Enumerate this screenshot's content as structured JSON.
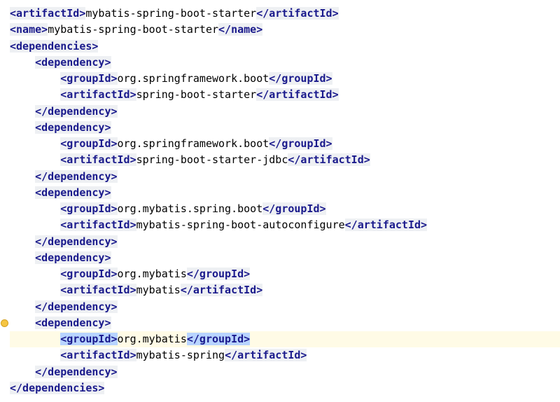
{
  "tags": {
    "artifactId_open": "<artifactId>",
    "artifactId_close": "</artifactId>",
    "name_open": "<name>",
    "name_close": "</name>",
    "dependencies_open": "<dependencies>",
    "dependencies_close": "</dependencies>",
    "dependency_open": "<dependency>",
    "dependency_close": "</dependency>",
    "groupId_open": "<groupId>",
    "groupId_close": "</groupId>"
  },
  "header": {
    "artifactId": "mybatis-spring-boot-starter",
    "name": "mybatis-spring-boot-starter"
  },
  "dependencies": [
    {
      "groupId": "org.springframework.boot",
      "artifactId": "spring-boot-starter"
    },
    {
      "groupId": "org.springframework.boot",
      "artifactId": "spring-boot-starter-jdbc"
    },
    {
      "groupId": "org.mybatis.spring.boot",
      "artifactId": "mybatis-spring-boot-autoconfigure"
    },
    {
      "groupId": "org.mybatis",
      "artifactId": "mybatis"
    },
    {
      "groupId": "org.mybatis",
      "artifactId": "mybatis-spring"
    }
  ],
  "cursor": {
    "dependency_index": 4,
    "field": "groupId"
  },
  "chart_data": null
}
